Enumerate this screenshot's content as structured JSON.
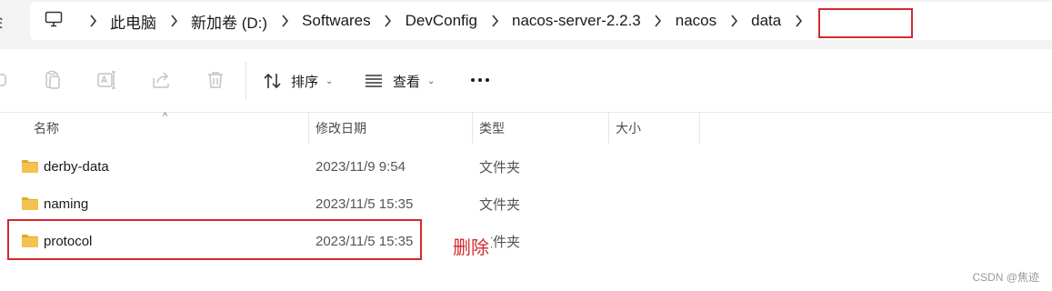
{
  "address_bar": {
    "left_glyph": "ﾐ",
    "crumbs": [
      "此电脑",
      "新加卷 (D:)",
      "Softwares",
      "DevConfig",
      "nacos-server-2.2.3",
      "nacos",
      "data"
    ]
  },
  "toolbar": {
    "sort_label": "排序",
    "view_label": "查看",
    "caret": "⌄"
  },
  "columns": {
    "name": "名称",
    "date": "修改日期",
    "type": "类型",
    "size": "大小",
    "sort_indicator": "^"
  },
  "files": [
    {
      "name": "derby-data",
      "date": "2023/11/9 9:54",
      "type": "文件夹",
      "size": ""
    },
    {
      "name": "naming",
      "date": "2023/11/5 15:35",
      "type": "文件夹",
      "size": ""
    },
    {
      "name": "protocol",
      "date": "2023/11/5 15:35",
      "type": "文件夹",
      "size": ""
    }
  ],
  "annotations": {
    "delete_note": "删除",
    "highlight_color": "#d4282f"
  },
  "watermark": "CSDN @焦迹",
  "colors": {
    "folder": "#f3c24f",
    "folder_dark": "#e0a82e",
    "address_bg": "#f3f3f3"
  }
}
